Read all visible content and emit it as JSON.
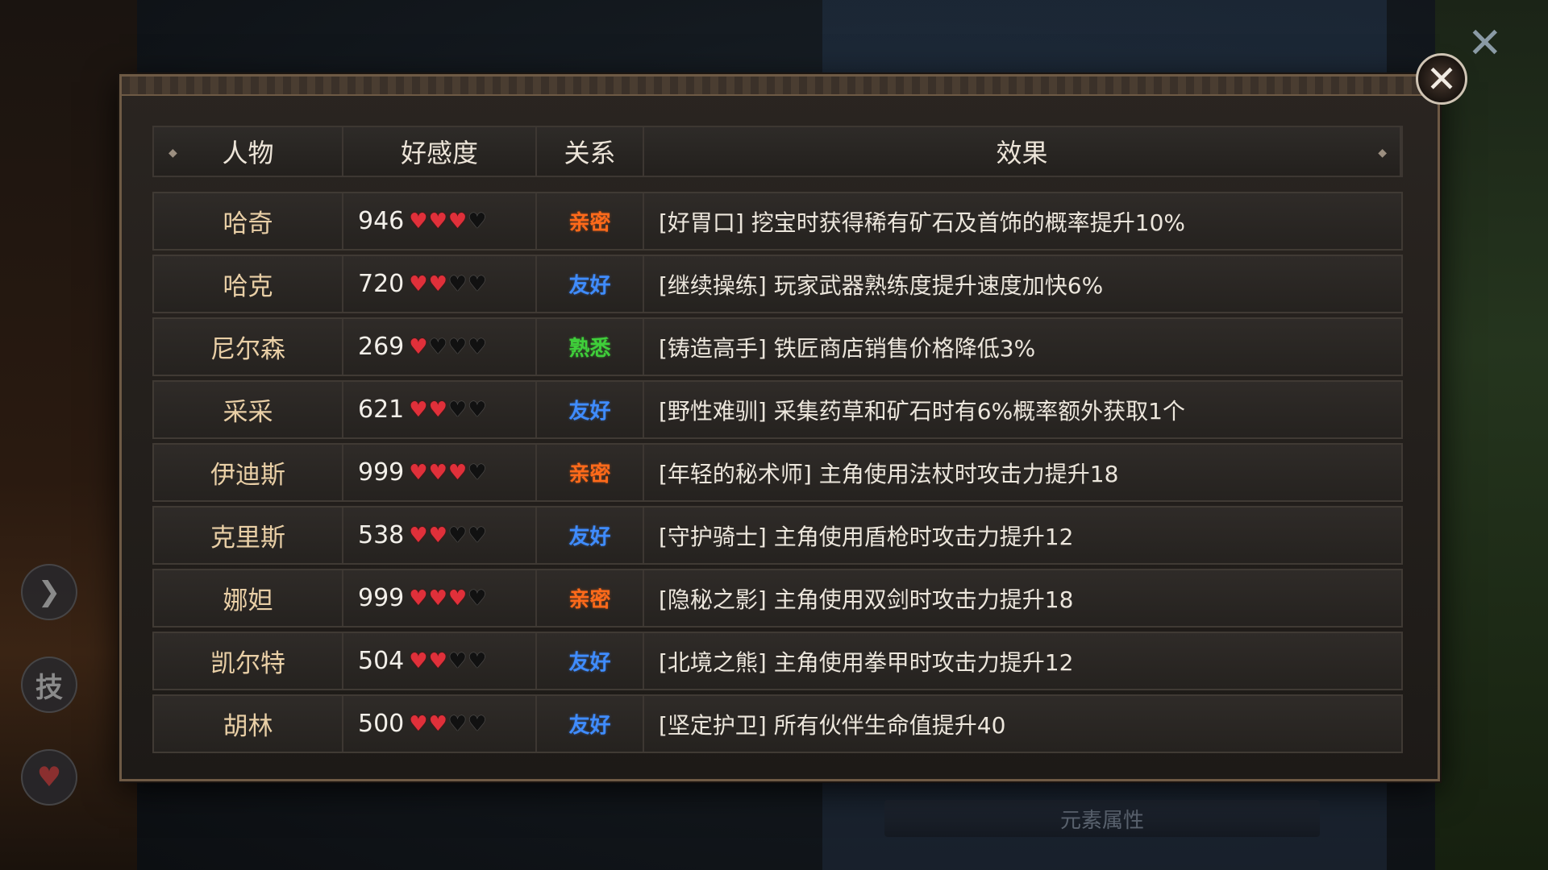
{
  "header": {
    "name": "人物",
    "favor": "好感度",
    "relation": "关系",
    "effect": "效果"
  },
  "relation_colors": {
    "亲密": "#ff6a1a",
    "友好": "#3f8cff",
    "熟悉": "#3fcf3a"
  },
  "rows": [
    {
      "name": "哈奇",
      "favor": "946",
      "hearts": 3,
      "relation": "亲密",
      "effect": "[好胃口] 挖宝时获得稀有矿石及首饰的概率提升10%"
    },
    {
      "name": "哈克",
      "favor": "720",
      "hearts": 2,
      "relation": "友好",
      "effect": "[继续操练] 玩家武器熟练度提升速度加快6%"
    },
    {
      "name": "尼尔森",
      "favor": "269",
      "hearts": 1,
      "relation": "熟悉",
      "effect": "[铸造高手] 铁匠商店销售价格降低3%"
    },
    {
      "name": "采采",
      "favor": "621",
      "hearts": 2,
      "relation": "友好",
      "effect": "[野性难驯] 采集药草和矿石时有6%概率额外获取1个"
    },
    {
      "name": "伊迪斯",
      "favor": "999",
      "hearts": 3,
      "relation": "亲密",
      "effect": "[年轻的秘术师] 主角使用法杖时攻击力提升18"
    },
    {
      "name": "克里斯",
      "favor": "538",
      "hearts": 2,
      "relation": "友好",
      "effect": "[守护骑士] 主角使用盾枪时攻击力提升12"
    },
    {
      "name": "娜妲",
      "favor": "999",
      "hearts": 3,
      "relation": "亲密",
      "effect": "[隐秘之影] 主角使用双剑时攻击力提升18"
    },
    {
      "name": "凯尔特",
      "favor": "504",
      "hearts": 2,
      "relation": "友好",
      "effect": "[北境之熊] 主角使用拳甲时攻击力提升12"
    },
    {
      "name": "胡林",
      "favor": "500",
      "hearts": 2,
      "relation": "友好",
      "effect": "[坚定护卫] 所有伙伴生命值提升40"
    }
  ],
  "hearts_max": 4,
  "side": {
    "skill_label": "技"
  },
  "bottom_tab": {
    "label": "元素属性"
  },
  "icons": {
    "close": "close-icon",
    "arrow": "arrow-right-icon",
    "heart": "heart-icon"
  }
}
